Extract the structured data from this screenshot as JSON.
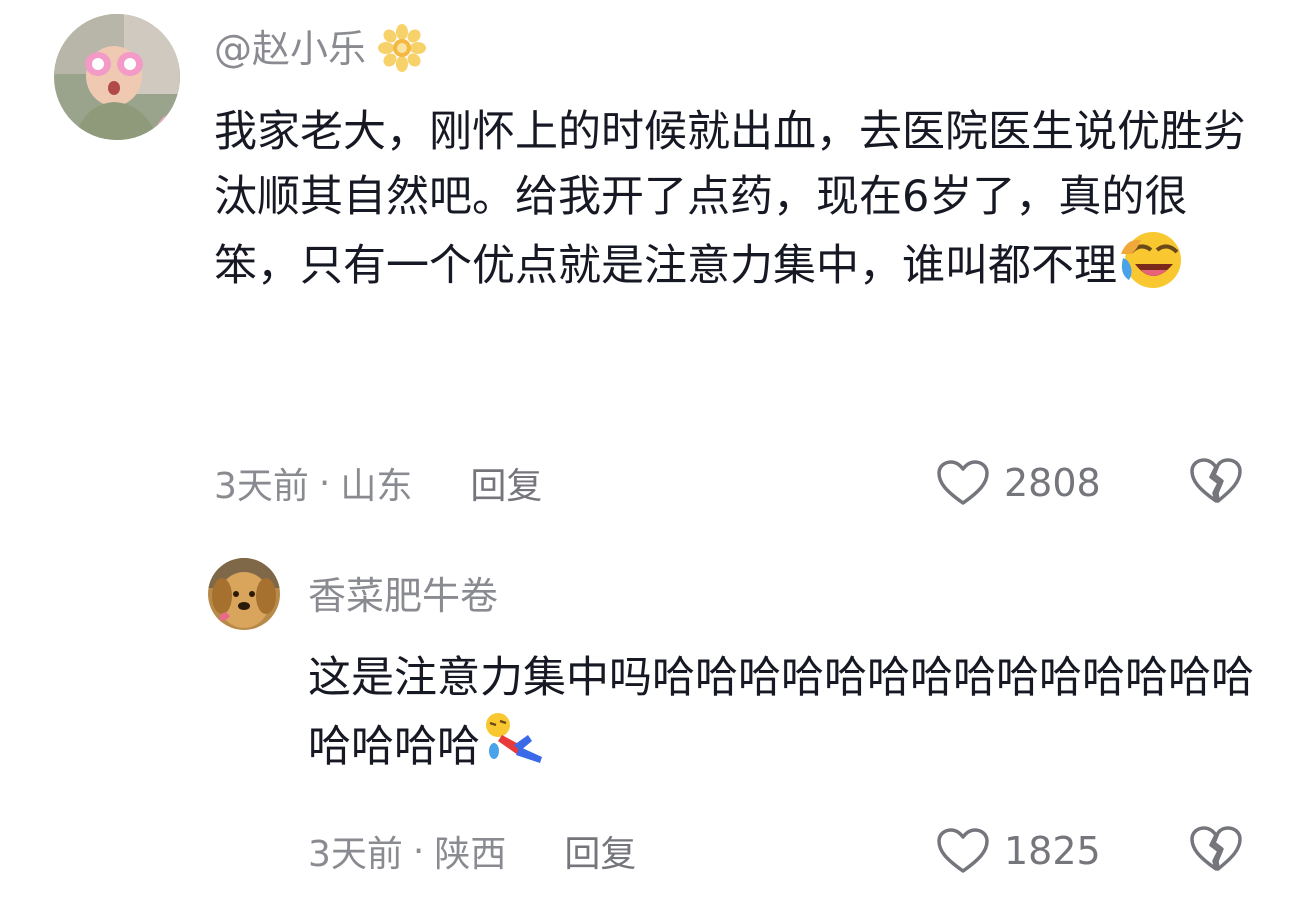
{
  "comments": [
    {
      "username": "@赵小乐",
      "text": "我家老大，刚怀上的时候就出血，去医院医生说优胜劣汰顺其自然吧。给我开了点药，现在6岁了，真的很笨，只有一个优点就是注意力集中，谁叫都不理",
      "time": "3天前",
      "dot": "·",
      "location": "山东",
      "reply_label": "回复",
      "likes": "2808",
      "trailing_emoji": "laugh-cry-emoji",
      "name_emoji": "flower-emoji"
    },
    {
      "username": "香菜肥牛卷",
      "text": "这是注意力集中吗哈哈哈哈哈哈哈哈哈哈哈哈哈哈哈哈哈哈",
      "time": "3天前",
      "dot": "·",
      "location": "陕西",
      "reply_label": "回复",
      "likes": "1825",
      "trailing_emoji": "fallen-over-emoji"
    }
  ],
  "colors": {
    "text": "#161823",
    "secondary": "#8a8b91",
    "icon": "#75767c"
  }
}
